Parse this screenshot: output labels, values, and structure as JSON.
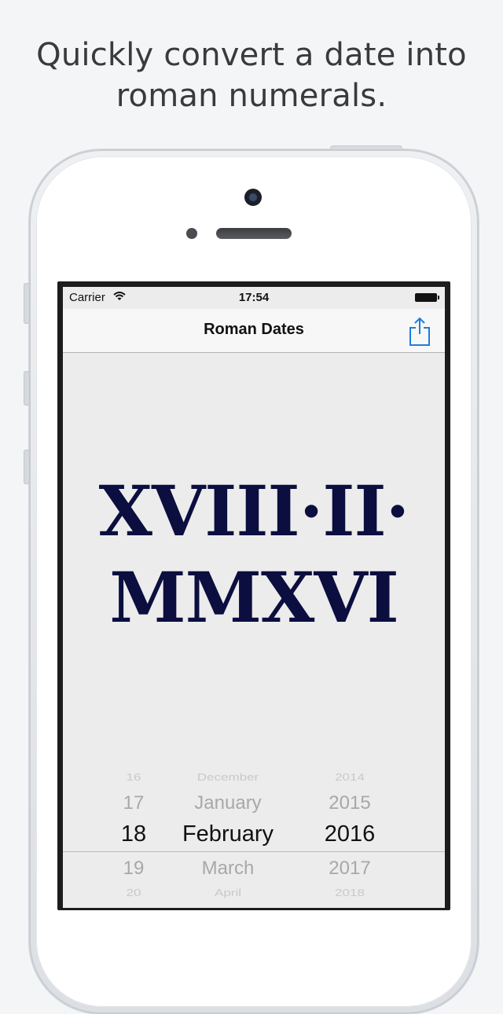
{
  "headline": {
    "line1": "Quickly convert a date into",
    "line2": "roman numerals."
  },
  "status_bar": {
    "carrier": "Carrier",
    "time": "17:54"
  },
  "nav": {
    "title": "Roman Dates",
    "share_icon": "share-icon"
  },
  "display": {
    "numeral_line1": "XVIII·II·",
    "numeral_line2": "MMXVI"
  },
  "picker": {
    "days": [
      "16",
      "17",
      "18",
      "19",
      "20"
    ],
    "months": [
      "December",
      "January",
      "February",
      "March",
      "April"
    ],
    "years": [
      "2014",
      "2015",
      "2016",
      "2017",
      "2018"
    ],
    "selected": {
      "day": "18",
      "month": "February",
      "year": "2016"
    }
  },
  "colors": {
    "numeral": "#0b0e3f",
    "share_icon": "#1e7ce0",
    "background": "#f4f5f7"
  }
}
